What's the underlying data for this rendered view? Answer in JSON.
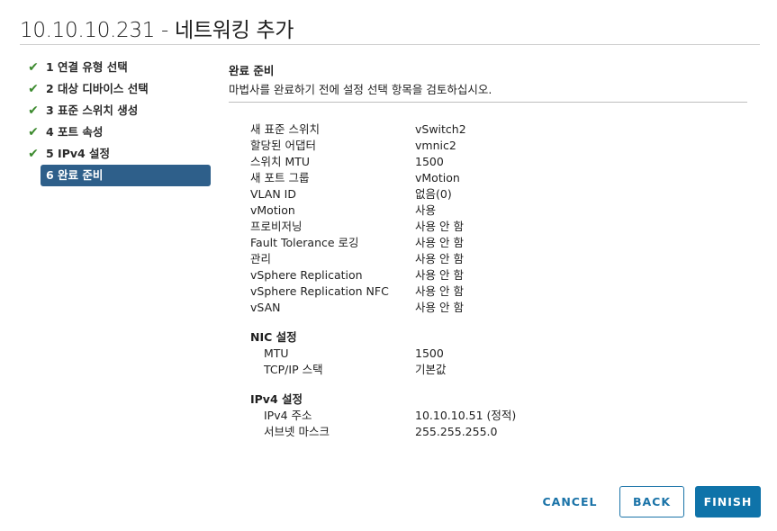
{
  "dialog": {
    "title": "10.10.10.231 - 네트워킹 추가"
  },
  "steps": [
    {
      "label": "1 연결 유형 선택",
      "done": true
    },
    {
      "label": "2 대상 디바이스 선택",
      "done": true
    },
    {
      "label": "3 표준 스위치 생성",
      "done": true
    },
    {
      "label": "4 포트 속성",
      "done": true
    },
    {
      "label": "5 IPv4 설정",
      "done": true
    },
    {
      "label": "6 완료 준비",
      "done": false,
      "active": true
    }
  ],
  "section": {
    "title": "완료 준비",
    "description": "마법사를 완료하기 전에 설정 선택 항목을 검토하십시오."
  },
  "summary": {
    "rows": [
      {
        "key": "새 표준 스위치",
        "value": "vSwitch2"
      },
      {
        "key": "할당된 어댑터",
        "value": "vmnic2"
      },
      {
        "key": "스위치 MTU",
        "value": "1500"
      },
      {
        "key": "새 포트 그룹",
        "value": "vMotion"
      },
      {
        "key": "VLAN ID",
        "value": "없음(0)"
      },
      {
        "key": "vMotion",
        "value": "사용"
      },
      {
        "key": "프로비저닝",
        "value": "사용 안 함"
      },
      {
        "key": "Fault Tolerance 로깅",
        "value": "사용 안 함"
      },
      {
        "key": "관리",
        "value": "사용 안 함"
      },
      {
        "key": "vSphere Replication",
        "value": "사용 안 함"
      },
      {
        "key": "vSphere Replication NFC",
        "value": "사용 안 함"
      },
      {
        "key": "vSAN",
        "value": "사용 안 함"
      }
    ],
    "nic": {
      "heading": "NIC 설정",
      "rows": [
        {
          "key": "MTU",
          "value": "1500"
        },
        {
          "key": "TCP/IP 스택",
          "value": "기본값"
        }
      ]
    },
    "ipv4": {
      "heading": "IPv4 설정",
      "rows": [
        {
          "key": "IPv4 주소",
          "value": "10.10.10.51 (정적)"
        },
        {
          "key": "서브넷 마스크",
          "value": "255.255.255.0"
        }
      ]
    }
  },
  "buttons": {
    "cancel": "CANCEL",
    "back": "BACK",
    "finish": "FINISH"
  },
  "icons": {
    "step_done": "check-icon"
  },
  "colors": {
    "accent": "#0f73a9",
    "active_step": "#2e5f8a",
    "check": "#3c8a2e"
  }
}
